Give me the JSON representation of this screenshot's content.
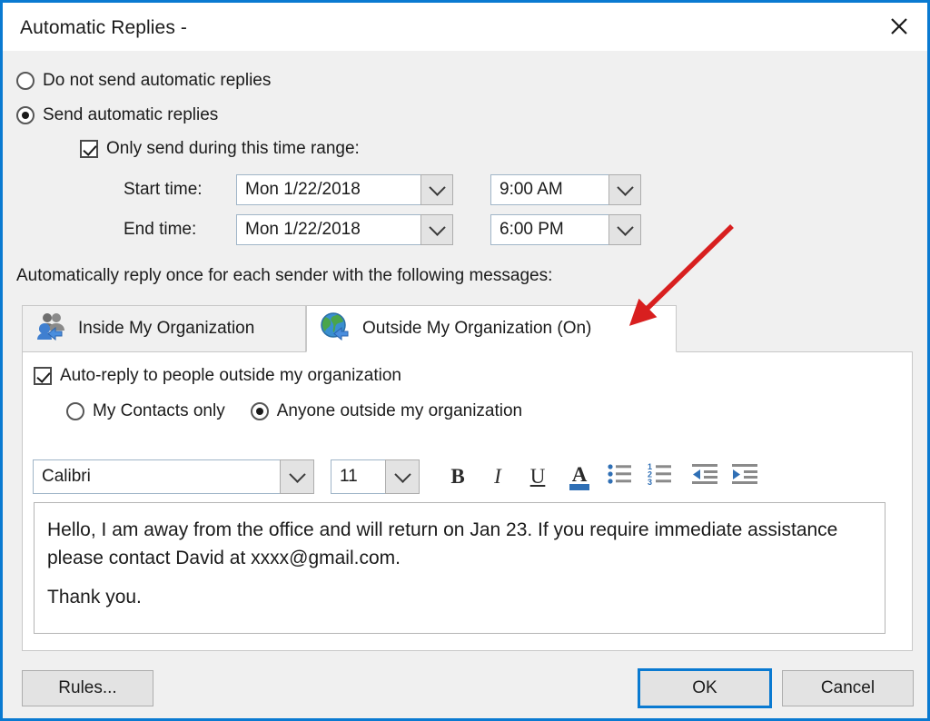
{
  "window": {
    "title": "Automatic Replies -",
    "close_icon": "close-icon"
  },
  "options": {
    "do_not_send_label": "Do not send automatic replies",
    "send_label": "Send automatic replies",
    "send_selected": true,
    "time_range_label": "Only send during this time range:",
    "time_range_checked": true
  },
  "schedule": {
    "start_label": "Start time:",
    "start_date": "Mon 1/22/2018",
    "start_time": "9:00 AM",
    "end_label": "End time:",
    "end_date": "Mon 1/22/2018",
    "end_time": "6:00 PM"
  },
  "instruction": "Automatically reply once for each sender with the following messages:",
  "tabs": [
    {
      "label": "Inside My Organization",
      "icon": "people-group-icon",
      "active": false
    },
    {
      "label": "Outside My Organization (On)",
      "icon": "globe-icon",
      "active": true
    }
  ],
  "panel": {
    "autoreply_label": "Auto-reply to people outside my organization",
    "autoreply_checked": true,
    "audience": [
      {
        "label": "My Contacts only",
        "selected": false
      },
      {
        "label": "Anyone outside my organization",
        "selected": true
      }
    ],
    "toolbar": {
      "font_name": "Calibri",
      "font_size": "11",
      "bold_label": "B",
      "italic_label": "I",
      "underline_label": "U",
      "font_color_label": "A",
      "bullets_icon": "bulleted-list-icon",
      "numbering_icon": "numbered-list-icon",
      "decrease_indent_icon": "decrease-indent-icon",
      "increase_indent_icon": "increase-indent-icon"
    },
    "message": {
      "paragraph1": "Hello, I am away from the office and will return on Jan 23. If you require immediate assistance please contact David at xxxx@gmail.com.",
      "paragraph2": "Thank you."
    }
  },
  "footer": {
    "rules_label": "Rules...",
    "ok_label": "OK",
    "cancel_label": "Cancel"
  },
  "annotation": {
    "arrow_color": "#d81f1f",
    "points_to": "Outside My Organization (On)"
  },
  "colors": {
    "accent": "#0a7ad1",
    "dialog_bg": "#f0f0f0",
    "panel_bg": "#ffffff",
    "arrow_red": "#d81f1f"
  }
}
